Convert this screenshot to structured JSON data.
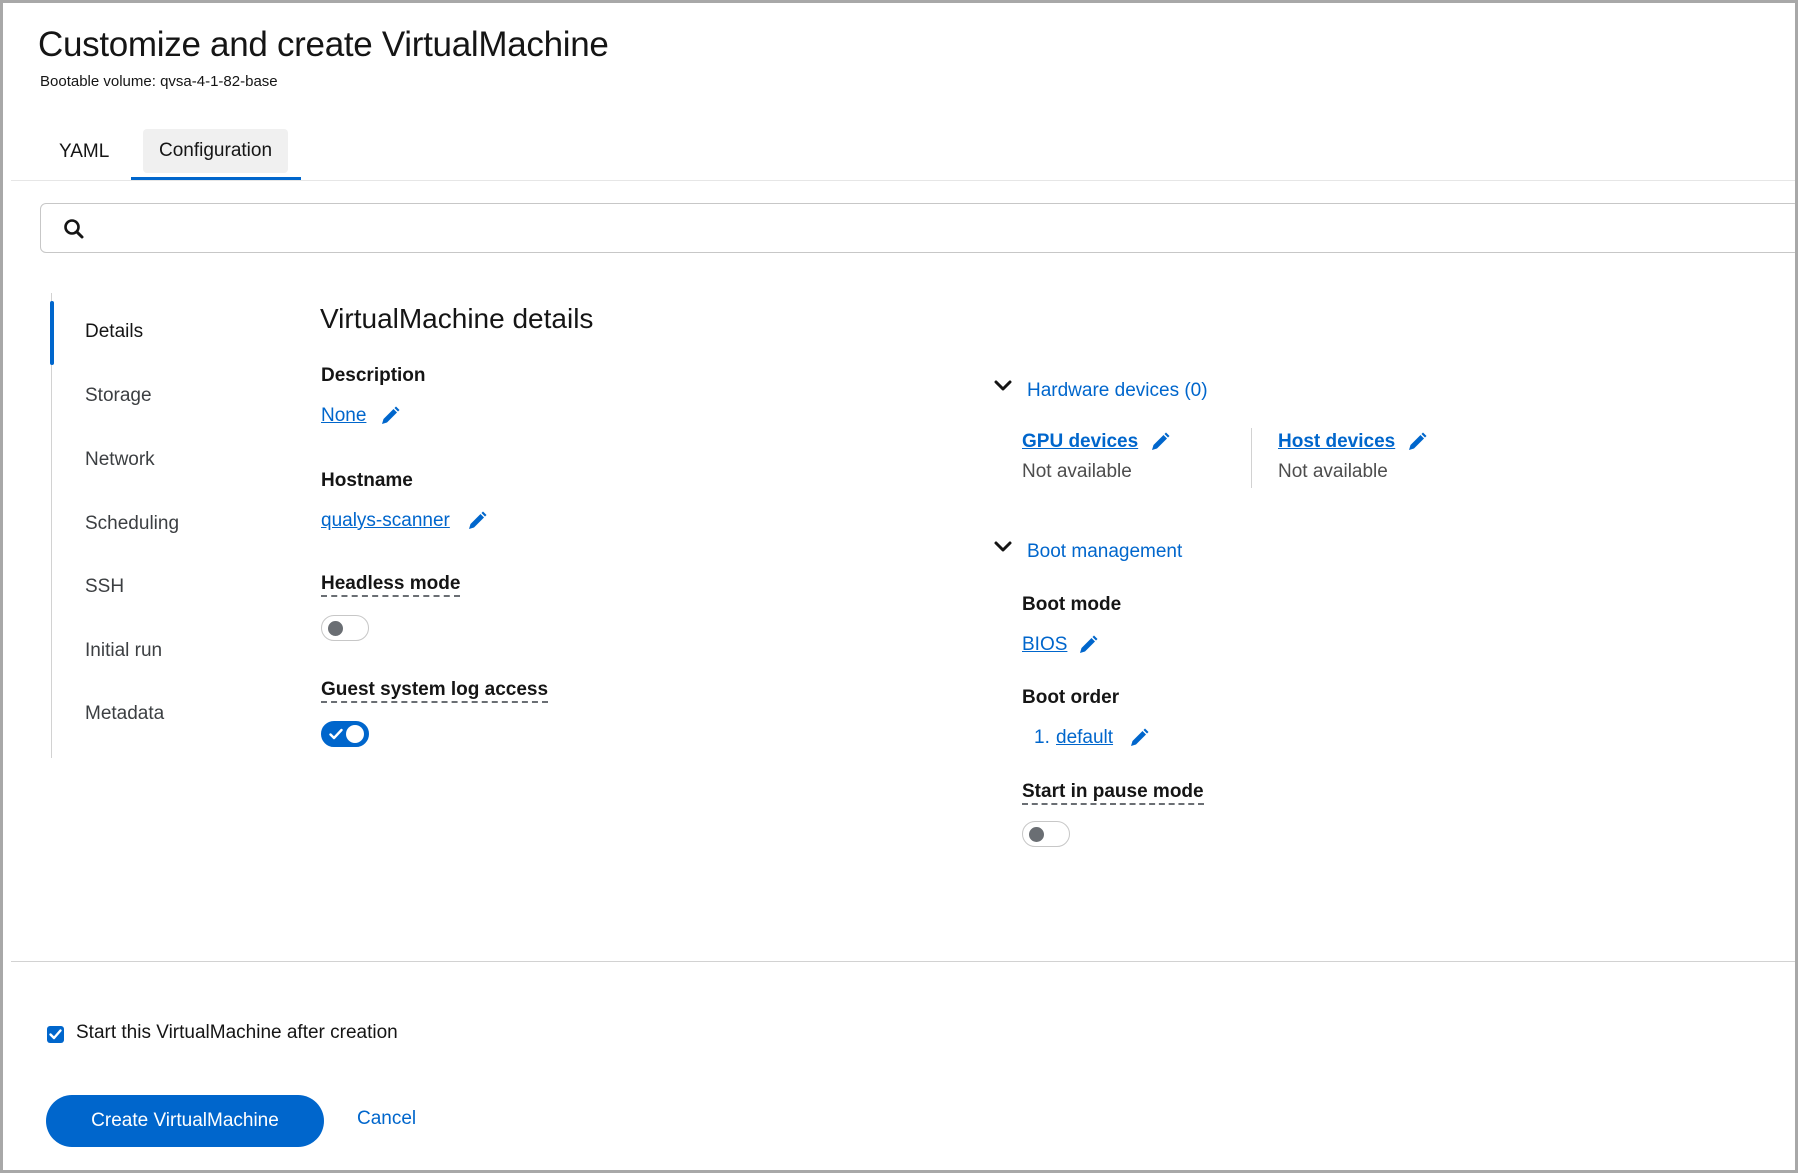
{
  "header": {
    "title": "Customize and create VirtualMachine",
    "subtitle": "Bootable volume: qvsa-4-1-82-base"
  },
  "tabs": [
    {
      "label": "YAML",
      "active": false
    },
    {
      "label": "Configuration",
      "active": true
    }
  ],
  "search": {
    "placeholder": "",
    "icon": "search-icon"
  },
  "nav": {
    "items": [
      {
        "label": "Details",
        "active": true
      },
      {
        "label": "Storage",
        "active": false
      },
      {
        "label": "Network",
        "active": false
      },
      {
        "label": "Scheduling",
        "active": false
      },
      {
        "label": "SSH",
        "active": false
      },
      {
        "label": "Initial run",
        "active": false
      },
      {
        "label": "Metadata",
        "active": false
      }
    ]
  },
  "details": {
    "title": "VirtualMachine details",
    "description": {
      "label": "Description",
      "value": "None"
    },
    "hostname": {
      "label": "Hostname",
      "value": "qualys-scanner"
    },
    "headless_mode": {
      "label": "Headless mode",
      "enabled": false
    },
    "guest_log_access": {
      "label": "Guest system log access",
      "enabled": true
    }
  },
  "hardware": {
    "title": "Hardware devices (0)",
    "gpu": {
      "label": "GPU devices",
      "value": "Not available"
    },
    "host": {
      "label": "Host devices",
      "value": "Not available"
    }
  },
  "boot": {
    "title": "Boot management",
    "mode": {
      "label": "Boot mode",
      "value": "BIOS"
    },
    "order": {
      "label": "Boot order",
      "index": "1.",
      "value": "default"
    },
    "pause": {
      "label": "Start in pause mode",
      "enabled": false
    }
  },
  "footer": {
    "start_after_creation": {
      "label": "Start this VirtualMachine after creation",
      "checked": true
    },
    "create_label": "Create VirtualMachine",
    "cancel_label": "Cancel"
  },
  "colors": {
    "accent": "#0066cc",
    "text": "#151515",
    "muted": "#4d4d4d",
    "border": "#d2d2d2"
  }
}
